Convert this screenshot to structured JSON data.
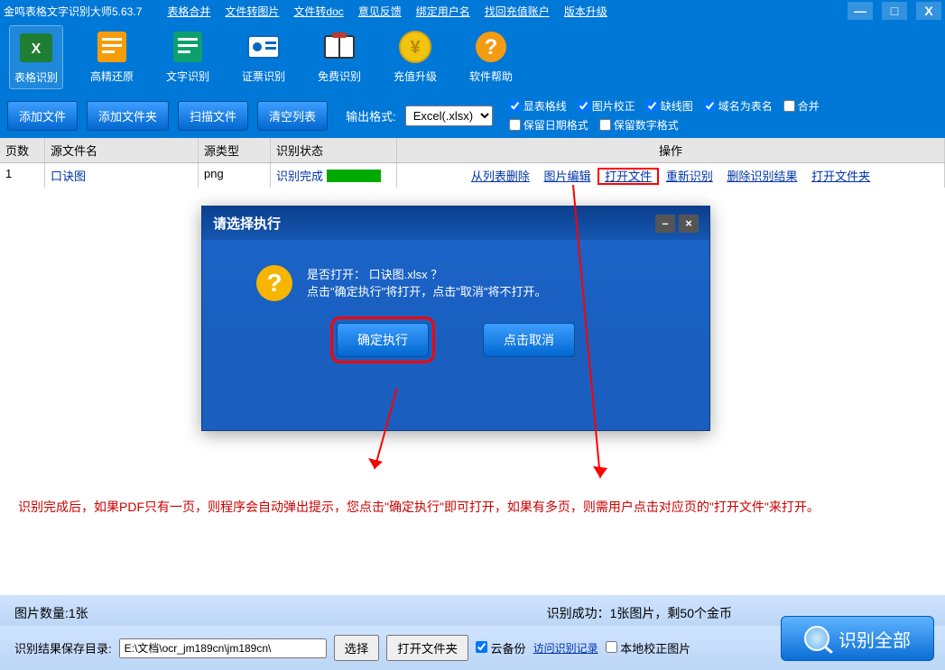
{
  "app": {
    "title": "金鸣表格文字识别大师5.63.7"
  },
  "menu": [
    "表格合并",
    "文件转图片",
    "文件转doc",
    "意见反馈",
    "绑定用户名",
    "找回充值账户",
    "版本升级"
  ],
  "window_buttons": {
    "min": "—",
    "max": "□",
    "close": "X"
  },
  "tools": [
    {
      "id": "table-recognize",
      "label": "表格识别",
      "icon": "excel",
      "active": true
    },
    {
      "id": "hd-restore",
      "label": "高精还原",
      "icon": "doc-orange"
    },
    {
      "id": "text-recognize",
      "label": "文字识别",
      "icon": "doc-green"
    },
    {
      "id": "id-recognize",
      "label": "证票识别",
      "icon": "idcard"
    },
    {
      "id": "free-recognize",
      "label": "免费识别",
      "icon": "book"
    },
    {
      "id": "recharge",
      "label": "充值升级",
      "icon": "coin"
    },
    {
      "id": "help",
      "label": "软件帮助",
      "icon": "help"
    }
  ],
  "actions": {
    "add_file": "添加文件",
    "add_folder": "添加文件夹",
    "scan_file": "扫描文件",
    "clear_list": "清空列表",
    "output_label": "输出格式:",
    "output_format": "Excel(.xlsx)"
  },
  "checks": [
    {
      "id": "show-grid",
      "label": "显表格线",
      "checked": true
    },
    {
      "id": "img-correct",
      "label": "图片校正",
      "checked": true
    },
    {
      "id": "missing-line",
      "label": "缺线图",
      "checked": true
    },
    {
      "id": "domain-sheet",
      "label": "域名为表名",
      "checked": true
    },
    {
      "id": "merge",
      "label": "合并",
      "checked": false
    },
    {
      "id": "keep-date",
      "label": "保留日期格式",
      "checked": false
    },
    {
      "id": "keep-num",
      "label": "保留数字格式",
      "checked": false
    }
  ],
  "table": {
    "headers": {
      "page": "页数",
      "name": "源文件名",
      "type": "源类型",
      "status": "识别状态",
      "ops": "操作"
    },
    "row": {
      "page": "1",
      "name": "口诀图",
      "type": "png",
      "status": "识别完成",
      "ops": [
        "从列表删除",
        "图片编辑",
        "打开文件",
        "重新识别",
        "删除识别结果",
        "打开文件夹"
      ]
    }
  },
  "dialog": {
    "title": "请选择执行",
    "line1": "是否打开： 口诀图.xlsx ？",
    "line2": "点击\"确定执行\"将打开，点击\"取消\"将不打开。",
    "ok": "确定执行",
    "cancel": "点击取消"
  },
  "instruction": "识别完成后，如果PDF只有一页，则程序会自动弹出提示，您点击\"确定执行\"即可打开，如果有多页，则需用户点击对应页的\"打开文件\"来打开。",
  "footer": {
    "img_count": "图片数量:1张",
    "success": "识别成功：1张图片，剩50个金币",
    "save_dir_label": "识别结果保存目录:",
    "save_dir": "E:\\文档\\ocr_jm189cn\\jm189cn\\",
    "select": "选择",
    "open_folder": "打开文件夹",
    "cloud_backup": "云备份",
    "visit_log": "访问识别记录",
    "local_correct": "本地校正图片",
    "recognize_all": "识别全部"
  }
}
